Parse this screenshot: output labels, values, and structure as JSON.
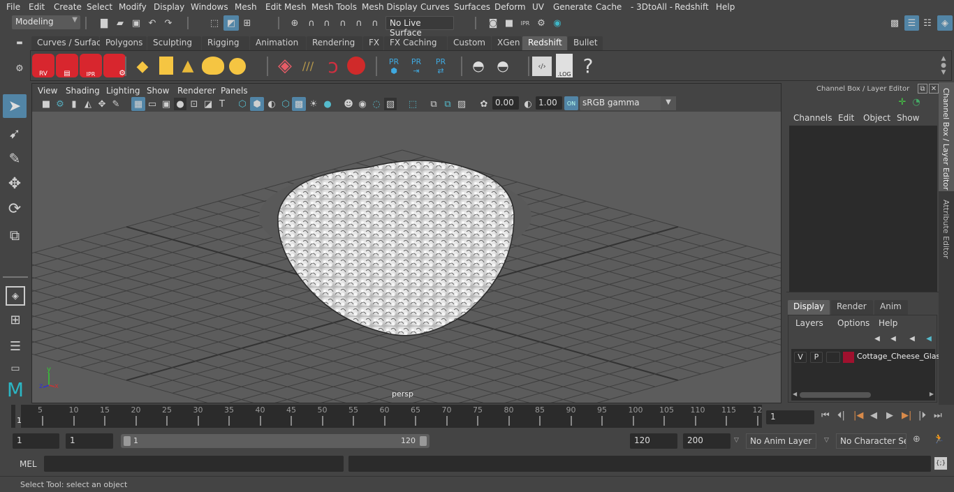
{
  "menubar": [
    "File",
    "Edit",
    "Create",
    "Select",
    "Modify",
    "Display",
    "Windows",
    "Mesh",
    "Edit Mesh",
    "Mesh Tools",
    "Mesh Display",
    "Curves",
    "Surfaces",
    "Deform",
    "UV",
    "Generate",
    "Cache",
    "- 3DtoAll -",
    "Redshift",
    "Help"
  ],
  "statusline": {
    "mode": "Modeling",
    "live_surface": "No Live Surface"
  },
  "shelf": {
    "tabs": [
      "Curves / Surfaces",
      "Polygons",
      "Sculpting",
      "Rigging",
      "Animation",
      "Rendering",
      "FX",
      "FX Caching",
      "Custom",
      "XGen",
      "Redshift",
      "Bullet"
    ],
    "active_tab": "Redshift",
    "icons": [
      "redshift-rv-icon",
      "redshift-render-icon",
      "redshift-ipr-icon",
      "redshift-settings-icon",
      "rs-area-light-icon",
      "rs-portal-light-icon",
      "rs-ies-light-icon",
      "rs-dome-light-icon",
      "rs-sun-sky-icon",
      "rs-proxy-icon",
      "rs-hair-icon",
      "rs-volume-icon",
      "rs-sphere-icon",
      "pr-mesh-icon",
      "pr-export-icon",
      "pr-transfer-icon",
      "bake-icon",
      "bake-all-icon",
      "script-icon",
      "log-icon",
      "help-icon"
    ],
    "pr_label": "PR",
    "ipr_label": "IPR",
    "rv_label": "RV",
    "log_label": ".LOG",
    "help_label": "?"
  },
  "viewport": {
    "menu": [
      "View",
      "Shading",
      "Lighting",
      "Show",
      "Renderer",
      "Panels"
    ],
    "exposure": "0.00",
    "gamma": "1.00",
    "color_space": "sRGB gamma",
    "camera_label": "persp",
    "axis": {
      "x": "x",
      "y": "y",
      "z": "z"
    }
  },
  "channel_box": {
    "title": "Channel Box / Layer Editor",
    "menu": [
      "Channels",
      "Edit",
      "Object",
      "Show"
    ],
    "layer_tabs": [
      "Display",
      "Render",
      "Anim"
    ],
    "active_layer_tab": "Display",
    "layer_menu": [
      "Layers",
      "Options",
      "Help"
    ],
    "layers": [
      {
        "v": "V",
        "p": "P",
        "color": "#a0112e",
        "name": "Cottage_Cheese_Glass"
      }
    ]
  },
  "side_tabs": [
    "Channel Box / Layer Editor",
    "Attribute Editor"
  ],
  "timeline": {
    "ticks": [
      "5",
      "10",
      "15",
      "20",
      "25",
      "30",
      "35",
      "40",
      "45",
      "50",
      "55",
      "60",
      "65",
      "70",
      "75",
      "80",
      "85",
      "90",
      "95",
      "100",
      "105",
      "110",
      "115",
      "12"
    ],
    "start_label": "1",
    "current_frame": "1"
  },
  "range": {
    "start": "1",
    "playback_start": "1",
    "slider_start": "1",
    "slider_end": "120",
    "playback_end": "120",
    "end": "200",
    "anim_layer": "No Anim Layer",
    "character_set": "No Character Set"
  },
  "command": {
    "lang": "MEL",
    "value": ""
  },
  "help_line": "Select Tool: select an object"
}
